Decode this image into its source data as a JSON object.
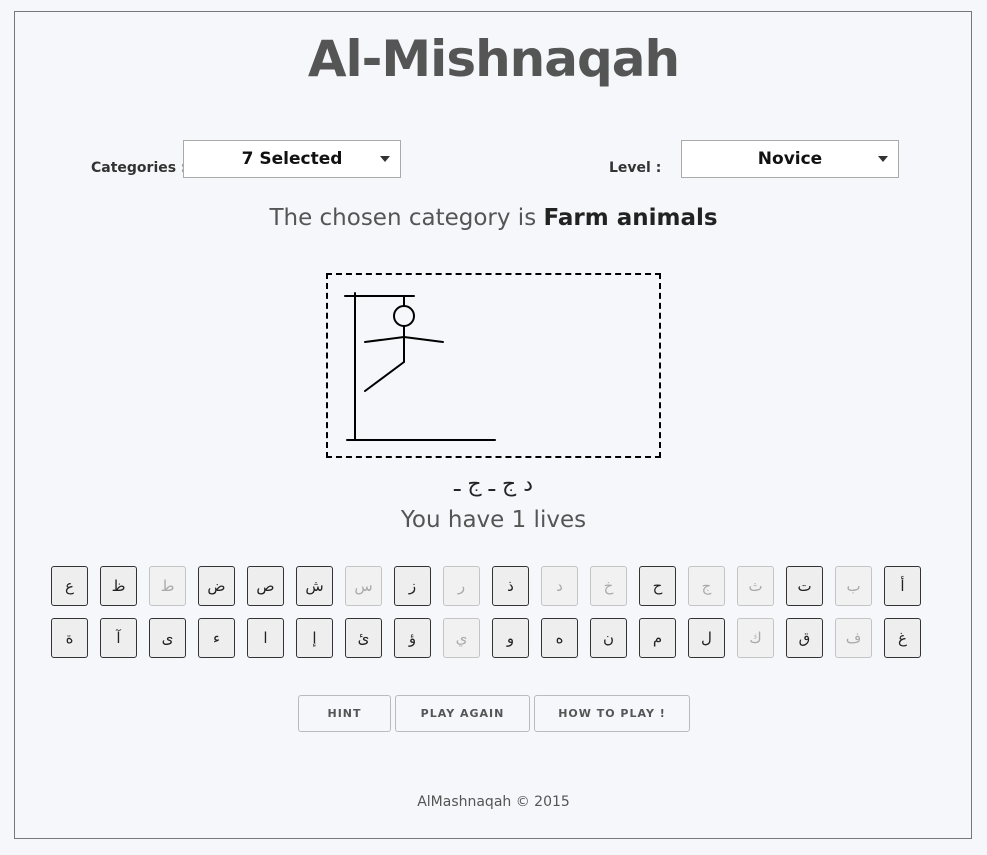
{
  "title": "Al-Mishnaqah",
  "controls": {
    "categories_label": "Categories :",
    "categories_value": "7 Selected",
    "level_label": "Level :",
    "level_value": "Novice"
  },
  "category_line": {
    "prefix": "The chosen category is",
    "category": "Farm animals"
  },
  "hangman": {
    "wrong_guesses_drawn": 6
  },
  "word_display": "د ج ـ ج ـ",
  "lives_text": "You have 1 lives",
  "keyboard": {
    "row1": [
      {
        "letter": "ع",
        "used": false
      },
      {
        "letter": "ظ",
        "used": false
      },
      {
        "letter": "ط",
        "used": true
      },
      {
        "letter": "ض",
        "used": false
      },
      {
        "letter": "ص",
        "used": false
      },
      {
        "letter": "ش",
        "used": false
      },
      {
        "letter": "س",
        "used": true
      },
      {
        "letter": "ز",
        "used": false
      },
      {
        "letter": "ر",
        "used": true
      },
      {
        "letter": "ذ",
        "used": false
      },
      {
        "letter": "د",
        "used": true
      },
      {
        "letter": "خ",
        "used": true
      },
      {
        "letter": "ح",
        "used": false
      },
      {
        "letter": "ج",
        "used": true
      },
      {
        "letter": "ث",
        "used": true
      },
      {
        "letter": "ت",
        "used": false
      },
      {
        "letter": "ب",
        "used": true
      },
      {
        "letter": "أ",
        "used": false
      }
    ],
    "row2": [
      {
        "letter": "ة",
        "used": false
      },
      {
        "letter": "آ",
        "used": false
      },
      {
        "letter": "ى",
        "used": false
      },
      {
        "letter": "ء",
        "used": false
      },
      {
        "letter": "ا",
        "used": false
      },
      {
        "letter": "إ",
        "used": false
      },
      {
        "letter": "ئ",
        "used": false
      },
      {
        "letter": "ؤ",
        "used": false
      },
      {
        "letter": "ي",
        "used": true
      },
      {
        "letter": "و",
        "used": false
      },
      {
        "letter": "ه",
        "used": false
      },
      {
        "letter": "ن",
        "used": false
      },
      {
        "letter": "م",
        "used": false
      },
      {
        "letter": "ل",
        "used": false
      },
      {
        "letter": "ك",
        "used": true
      },
      {
        "letter": "ق",
        "used": false
      },
      {
        "letter": "ف",
        "used": true
      },
      {
        "letter": "غ",
        "used": false
      }
    ]
  },
  "buttons": {
    "hint": "HINT",
    "play_again": "PLAY AGAIN",
    "how_to_play": "HOW TO PLAY !"
  },
  "footer": "AlMashnaqah © 2015",
  "colors": {
    "background": "#f6f7fb",
    "key_used_text": "#aaaaaa",
    "key_active_border": "#333333"
  }
}
